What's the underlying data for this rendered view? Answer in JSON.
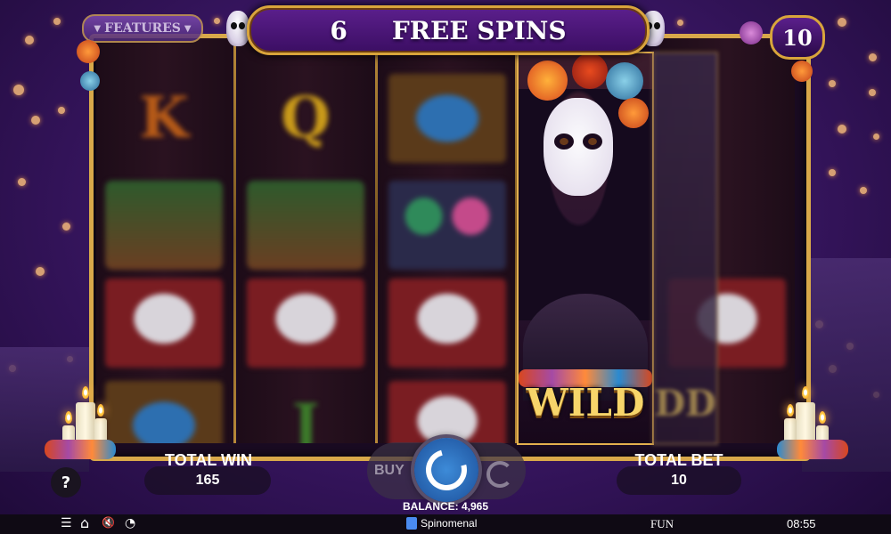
{
  "top": {
    "features_label": "FEATURES",
    "free_spins_count": "6",
    "free_spins_label": "FREE SPINS",
    "remaining_counter": "10"
  },
  "reels": {
    "reel1_symbols": [
      "K",
      "",
      "",
      ""
    ],
    "reel2_symbols": [
      "Q",
      "",
      "",
      "J"
    ],
    "wild_label": "WILD",
    "wild_blur_label": "DD"
  },
  "hud": {
    "total_win_label": "TOTAL WIN",
    "total_win_value": "165",
    "total_bet_label": "TOTAL BET",
    "total_bet_value": "10",
    "buy_label": "BUY",
    "help_label": "?",
    "balance_text": "BALANCE: 4,965"
  },
  "bottom_bar": {
    "menu_icon": "☰",
    "home_icon": "⌂",
    "sound_icon": "🔇",
    "speed_icon": "◔",
    "brand": "Spinomenal",
    "mode": "FUN",
    "time": "08:55"
  },
  "colors": {
    "gold": "#d8a84a",
    "purple": "#3b1766",
    "spin_blue": "#2f6fc0"
  }
}
